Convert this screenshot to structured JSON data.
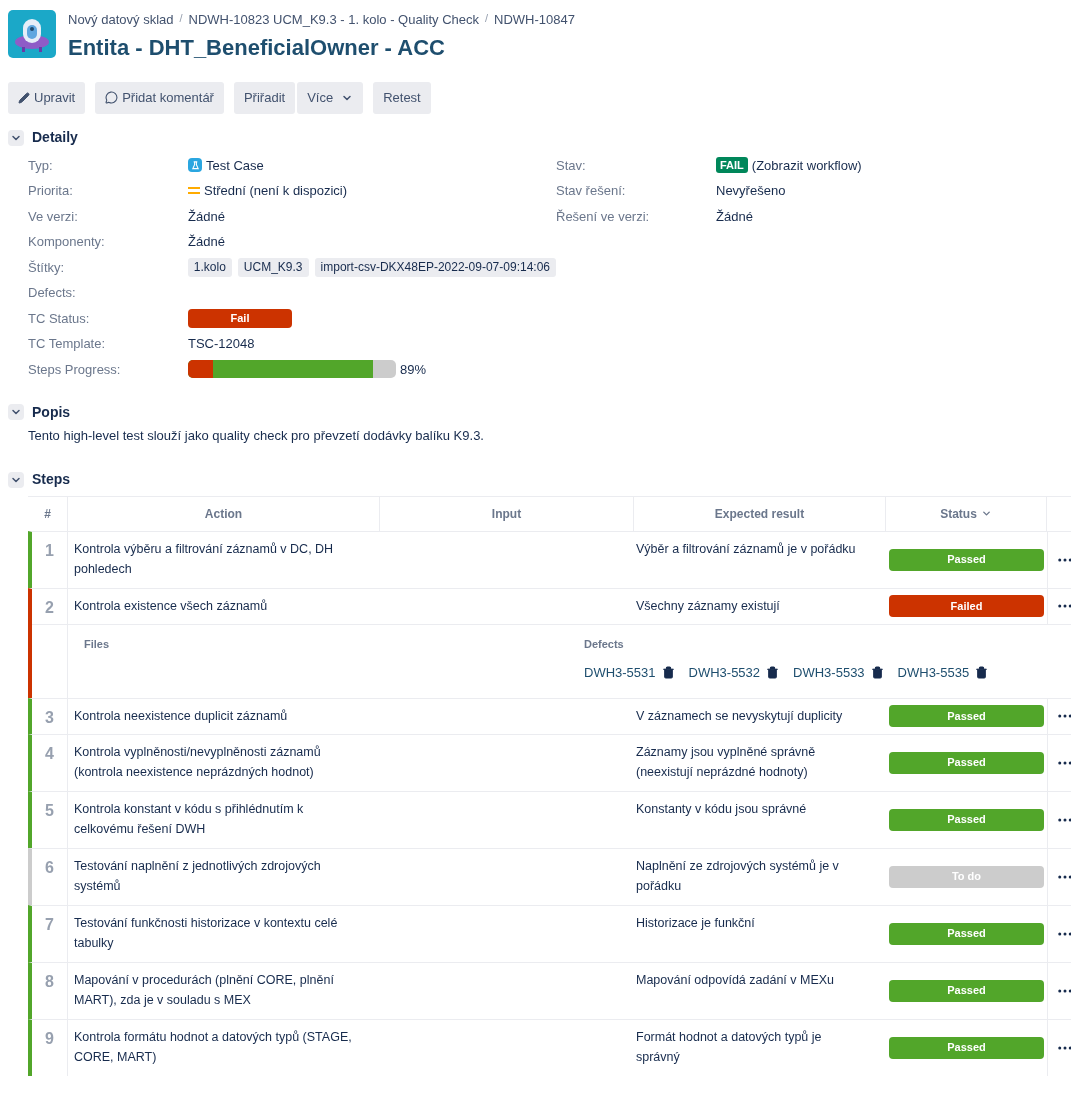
{
  "breadcrumbs": [
    {
      "label": "Nový datový sklad",
      "separator": "/"
    },
    {
      "label": "NDWH-10823 UCM_K9.3 - 1. kolo - Quality Check",
      "separator": "/"
    },
    {
      "label": "NDWH-10847"
    }
  ],
  "title": "Entita - DHT_BeneficialOwner - ACC",
  "toolbar": [
    {
      "label": "Upravit",
      "kind": "edit"
    },
    {
      "label": "Přidat komentář",
      "kind": "comment"
    },
    {
      "label": "Přiřadit",
      "kind": "plain"
    },
    {
      "label": "Více",
      "kind": "dropdown"
    },
    {
      "label": "Retest",
      "kind": "plain"
    }
  ],
  "details": {
    "title": "Detaily",
    "expanded": true,
    "left": [
      {
        "label": "Typ:",
        "kind": "type",
        "value": "Test Case"
      },
      {
        "label": "Priorita:",
        "kind": "priority",
        "value": "Střední (není k dispozici)"
      },
      {
        "label": "Ve verzi:",
        "kind": "text",
        "value": "Žádné"
      },
      {
        "label": "Komponenty:",
        "kind": "text",
        "value": "Žádné"
      },
      {
        "label": "Štítky:",
        "kind": "labels",
        "labels": [
          "1.kolo",
          "UCM_K9.3",
          "import-csv-DKX48EP-2022-09-07-09:14:06"
        ]
      },
      {
        "label": "Defects:",
        "kind": "empty"
      },
      {
        "label": "TC Status:",
        "kind": "status",
        "value": "Fail"
      },
      {
        "label": "TC Template:",
        "kind": "text",
        "value": "TSC-12048"
      },
      {
        "label": "Steps Progress:",
        "kind": "progress",
        "segments": [
          {
            "color": "#cc3300",
            "level": 0.12
          },
          {
            "color": "#52a62a",
            "level": 0.89
          }
        ],
        "reading": "89%"
      }
    ],
    "right": [
      {
        "label": "Stav:",
        "kind": "lozenge",
        "value": "FAIL",
        "link": "(Zobrazit workflow)"
      },
      {
        "label": "Stav řešení:",
        "kind": "text",
        "value": "Nevyřešeno"
      },
      {
        "label": "Řešení ve verzi:",
        "kind": "text",
        "value": "Žádné"
      }
    ]
  },
  "description": {
    "title": "Popis",
    "expanded": true,
    "text": "Tento high-level test slouží jako quality check pro převzetí dodávky balíku K9.3."
  },
  "steps": {
    "title": "Steps",
    "expanded": true,
    "columns": [
      "#",
      "Action",
      "Input",
      "Expected result",
      "Status"
    ],
    "rows": [
      {
        "number": "1",
        "action": "Kontrola výběru a filtrování záznamů v DC, DH pohledech",
        "expected": "Výběr a filtrování záznamů je v pořádku",
        "kind": "passed",
        "status_label": "Passed"
      },
      {
        "number": "2",
        "action": "Kontrola existence všech záznamů",
        "expected": "Všechny záznamy existují",
        "kind": "failed",
        "status_label": "Failed",
        "files_label": "Files",
        "defects_label": "Defects",
        "defects": [
          "DWH3-5531",
          "DWH3-5532",
          "DWH3-5533",
          "DWH3-5535"
        ]
      },
      {
        "number": "3",
        "action": "Kontrola neexistence duplicit záznamů",
        "expected": "V záznamech se nevyskytují duplicity",
        "kind": "passed",
        "status_label": "Passed"
      },
      {
        "number": "4",
        "action": "Kontrola vyplněnosti/nevyplněnosti záznamů (kontrola neexistence neprázdných hodnot)",
        "expected": "Záznamy jsou vyplněné správně (neexistují neprázdné hodnoty)",
        "kind": "passed",
        "status_label": "Passed"
      },
      {
        "number": "5",
        "action": "Kontrola konstant v kódu s přihlédnutím k celkovému řešení DWH",
        "expected": "Konstanty v kódu jsou správné",
        "kind": "passed",
        "status_label": "Passed"
      },
      {
        "number": "6",
        "action": "Testování naplnění z jednotlivých zdrojových systémů",
        "expected": "Naplnění ze zdrojových systémů je v pořádku",
        "kind": "todo",
        "status_label": "To do"
      },
      {
        "number": "7",
        "action": "Testování funkčnosti historizace v kontextu celé tabulky",
        "expected": "Historizace je funkční",
        "kind": "passed",
        "status_label": "Passed"
      },
      {
        "number": "8",
        "action": "Mapování v procedurách (plnění CORE, plnění MART), zda je v souladu s MEX",
        "expected": "Mapování odpovídá zadání v MEXu",
        "kind": "passed",
        "status_label": "Passed"
      },
      {
        "number": "9",
        "action": "Kontrola formátu hodnot a datových typů (STAGE, CORE, MART)",
        "expected": "Formát hodnot a datových typů je správný",
        "kind": "passed",
        "status_label": "Passed"
      }
    ]
  }
}
